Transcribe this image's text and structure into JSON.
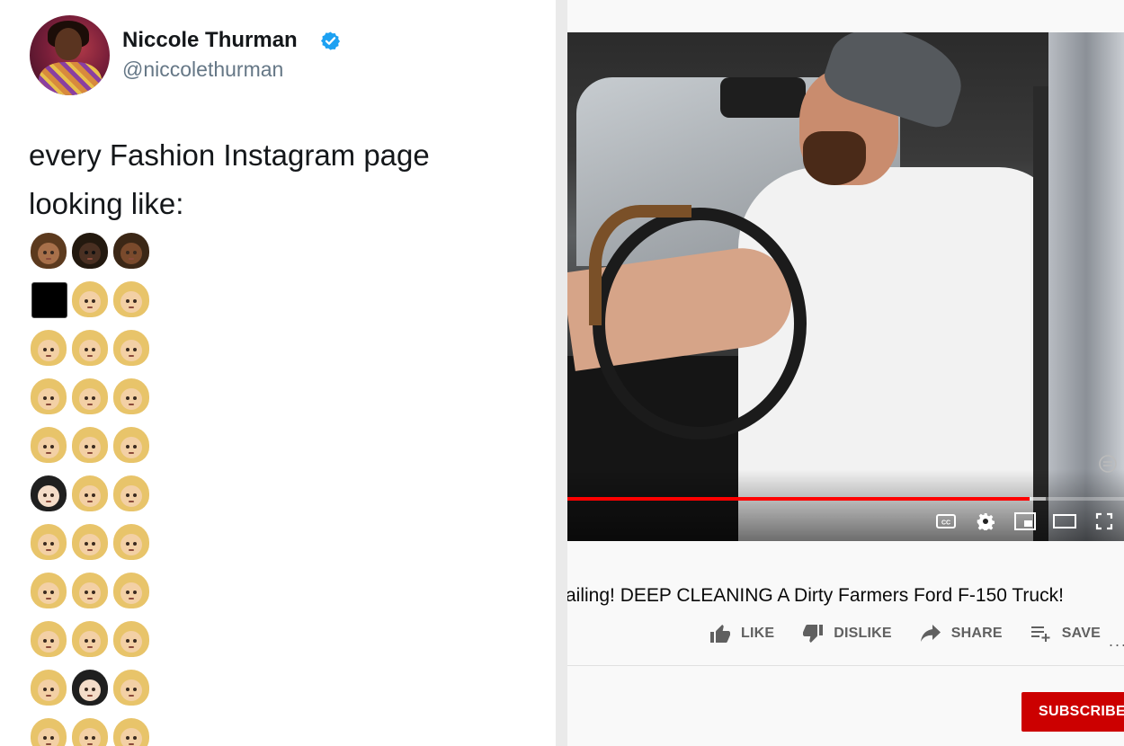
{
  "tweet": {
    "author_name": "Niccole Thurman",
    "handle": "@niccolethurman",
    "text_line1": "every Fashion Instagram page",
    "text_line2": "looking like:",
    "emoji_rows": [
      [
        "brown",
        "dark",
        "med"
      ],
      [
        "square",
        "blonde",
        "blonde"
      ],
      [
        "blonde",
        "blonde",
        "blonde"
      ],
      [
        "blonde",
        "blonde",
        "blonde"
      ],
      [
        "blonde",
        "blonde",
        "blonde"
      ],
      [
        "black",
        "blonde",
        "blonde"
      ],
      [
        "blonde",
        "blonde",
        "blonde"
      ],
      [
        "blonde",
        "blonde",
        "blonde"
      ],
      [
        "blonde",
        "blonde",
        "blonde"
      ],
      [
        "blonde",
        "black",
        "blonde"
      ],
      [
        "blonde",
        "blonde",
        "blonde"
      ]
    ],
    "icons": {
      "verified": "verified-badge-icon"
    },
    "colors": {
      "verified": "#1da1f2",
      "handle": "#657786"
    }
  },
  "video": {
    "title": "ailing! DEEP CLEANING A Dirty Farmers Ford F-150 Truck!",
    "progress_played": 0.83,
    "progress_buffered": 0.86,
    "controls": [
      "captions-icon",
      "settings-icon",
      "miniplayer-icon",
      "theater-mode-icon",
      "fullscreen-icon"
    ],
    "actions": {
      "like": "LIKE",
      "dislike": "DISLIKE",
      "share": "SHARE",
      "save": "SAVE",
      "more": "..."
    },
    "subscribe_label": "SUBSCRIBE",
    "colors": {
      "progress": "#ff0000",
      "subscribe": "#cc0000",
      "action_text": "#606060"
    }
  }
}
